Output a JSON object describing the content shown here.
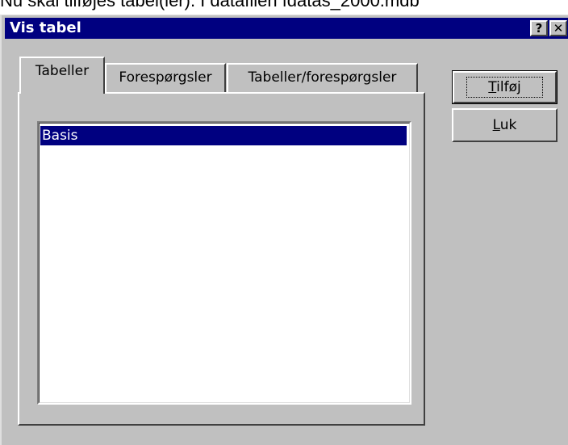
{
  "page": {
    "caption_text": "Nu skal tilføjes tabel(ler). I datafilen fdatas_2000.mdb"
  },
  "window": {
    "title": "Vis tabel",
    "help_glyph": "?",
    "close_glyph": "✕"
  },
  "tabs": [
    {
      "label": "Tabeller",
      "active": true
    },
    {
      "label": "Forespørgsler",
      "active": false
    },
    {
      "label": "Tabeller/forespørgsler",
      "active": false
    }
  ],
  "list": {
    "items": [
      {
        "label": "Basis",
        "selected": true
      }
    ]
  },
  "buttons": {
    "add": {
      "mnemonic": "T",
      "rest": "ilføj"
    },
    "close": {
      "mnemonic": "L",
      "rest": "uk"
    }
  },
  "colors": {
    "titlebar": "#000080",
    "face": "#c0c0c0",
    "selection": "#000080"
  }
}
